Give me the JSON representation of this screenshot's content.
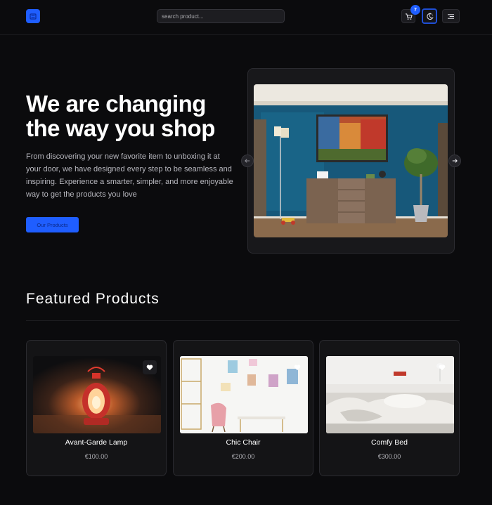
{
  "header": {
    "search_placeholder": "search product...",
    "cart_count": "7",
    "accent": "#1f5eff"
  },
  "hero": {
    "title_line1": "We are changing",
    "title_line2": "the way you shop",
    "description": "From discovering your new favorite item to unboxing it at your door, we have designed every step to be seamless and inspiring. Experience a smarter, simpler, and more enjoyable way to get the products you love",
    "cta_label": "Our Products"
  },
  "featured": {
    "title": "Featured Products",
    "products": [
      {
        "name": "Avant-Garde Lamp",
        "price": "€100.00"
      },
      {
        "name": "Chic Chair",
        "price": "€200.00"
      },
      {
        "name": "Comfy Bed",
        "price": "€300.00"
      }
    ]
  },
  "icons": {
    "logo": "store-icon",
    "cart": "cart-icon",
    "theme": "theme-toggle-icon",
    "menu": "menu-icon",
    "prev": "arrow-left-icon",
    "next": "arrow-right-icon",
    "favorite": "heart-icon"
  }
}
